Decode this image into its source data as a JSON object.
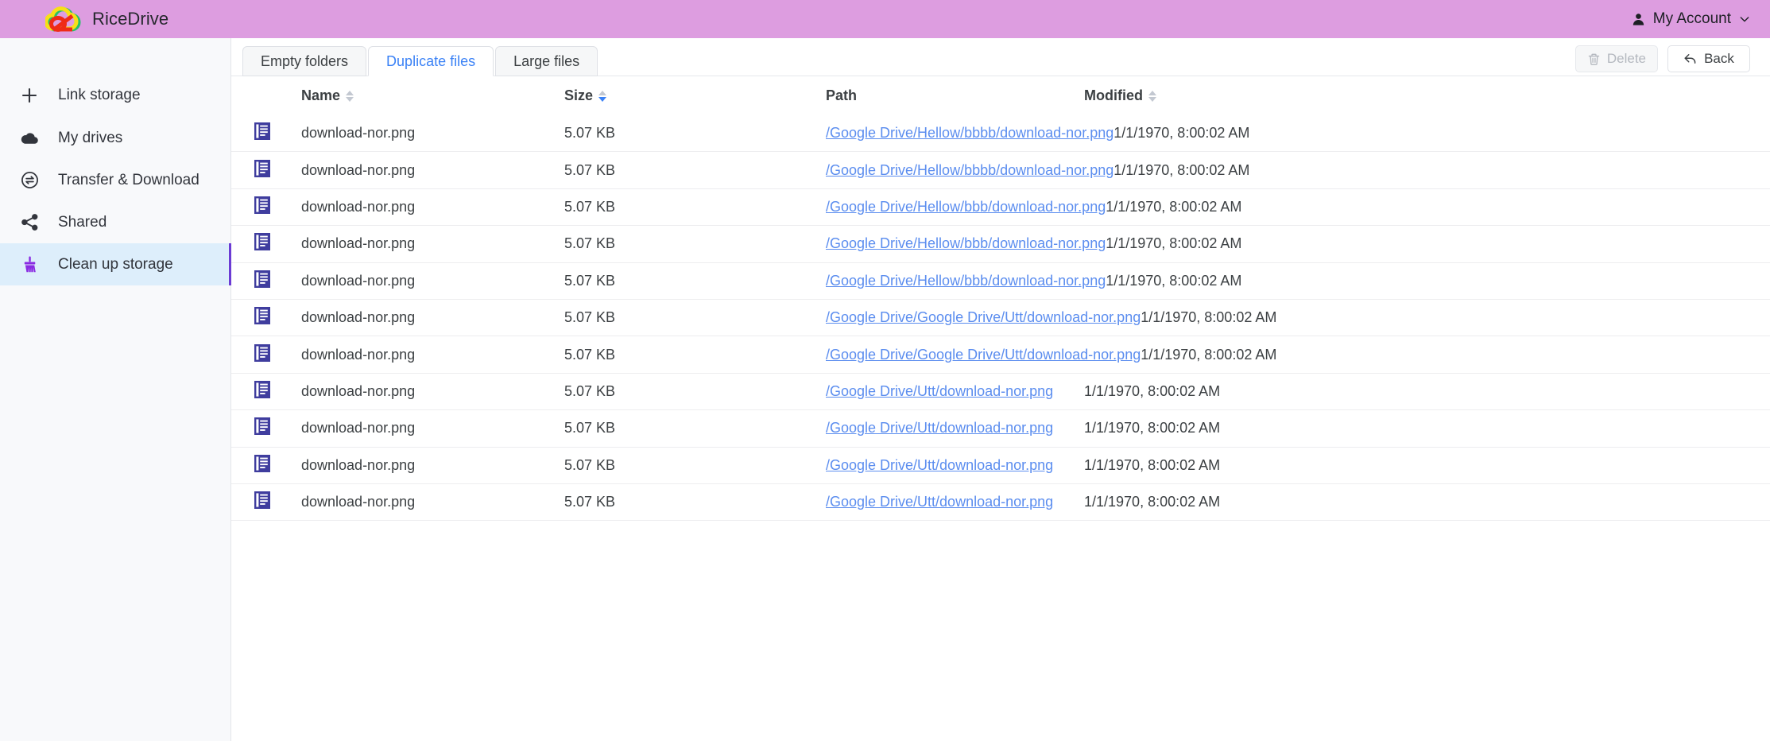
{
  "app": {
    "brand_name": "RiceDrive",
    "logo_icon": "cloud-slash-logo-icon"
  },
  "header": {
    "account_label": "My Account",
    "account_icon": "person-icon",
    "chevron_icon": "chevron-down-icon"
  },
  "sidebar": {
    "items": [
      {
        "label": "Link storage",
        "icon": "plus-icon",
        "active": false
      },
      {
        "label": "My drives",
        "icon": "cloud-icon",
        "active": false
      },
      {
        "label": "Transfer & Download",
        "icon": "transfer-icon",
        "active": false
      },
      {
        "label": "Shared",
        "icon": "share-icon",
        "active": false
      },
      {
        "label": "Clean up storage",
        "icon": "broom-icon",
        "active": true
      }
    ]
  },
  "toolbar": {
    "tabs": [
      {
        "label": "Empty folders",
        "active": false
      },
      {
        "label": "Duplicate files",
        "active": true
      },
      {
        "label": "Large files",
        "active": false
      }
    ],
    "delete_label": "Delete",
    "delete_icon": "trash-icon",
    "delete_disabled": true,
    "back_label": "Back",
    "back_icon": "reply-arrow-icon"
  },
  "table": {
    "columns": [
      {
        "key": "name",
        "label": "Name",
        "sortable": true,
        "sort_state": "none"
      },
      {
        "key": "size",
        "label": "Size",
        "sortable": true,
        "sort_state": "desc"
      },
      {
        "key": "path",
        "label": "Path",
        "sortable": false,
        "sort_state": "none"
      },
      {
        "key": "modified",
        "label": "Modified",
        "sortable": true,
        "sort_state": "none"
      }
    ],
    "row_icon": "document-file-icon",
    "rows": [
      {
        "name": "download-nor.png",
        "size": "5.07 KB",
        "path": "/Google Drive/Hellow/bbbb/download-nor.png",
        "modified": "1/1/1970, 8:00:02 AM"
      },
      {
        "name": "download-nor.png",
        "size": "5.07 KB",
        "path": "/Google Drive/Hellow/bbbb/download-nor.png",
        "modified": "1/1/1970, 8:00:02 AM"
      },
      {
        "name": "download-nor.png",
        "size": "5.07 KB",
        "path": "/Google Drive/Hellow/bbb/download-nor.png",
        "modified": "1/1/1970, 8:00:02 AM"
      },
      {
        "name": "download-nor.png",
        "size": "5.07 KB",
        "path": "/Google Drive/Hellow/bbb/download-nor.png",
        "modified": "1/1/1970, 8:00:02 AM"
      },
      {
        "name": "download-nor.png",
        "size": "5.07 KB",
        "path": "/Google Drive/Hellow/bbb/download-nor.png",
        "modified": "1/1/1970, 8:00:02 AM"
      },
      {
        "name": "download-nor.png",
        "size": "5.07 KB",
        "path": "/Google Drive/Google Drive/Utt/download-nor.png",
        "modified": "1/1/1970, 8:00:02 AM"
      },
      {
        "name": "download-nor.png",
        "size": "5.07 KB",
        "path": "/Google Drive/Google Drive/Utt/download-nor.png",
        "modified": "1/1/1970, 8:00:02 AM"
      },
      {
        "name": "download-nor.png",
        "size": "5.07 KB",
        "path": "/Google Drive/Utt/download-nor.png",
        "modified": "1/1/1970, 8:00:02 AM"
      },
      {
        "name": "download-nor.png",
        "size": "5.07 KB",
        "path": "/Google Drive/Utt/download-nor.png",
        "modified": "1/1/1970, 8:00:02 AM"
      },
      {
        "name": "download-nor.png",
        "size": "5.07 KB",
        "path": "/Google Drive/Utt/download-nor.png",
        "modified": "1/1/1970, 8:00:02 AM"
      },
      {
        "name": "download-nor.png",
        "size": "5.07 KB",
        "path": "/Google Drive/Utt/download-nor.png",
        "modified": "1/1/1970, 8:00:02 AM"
      }
    ]
  },
  "colors": {
    "header_bg": "#dd9de0",
    "sidebar_bg": "#f8f9fb",
    "active_nav_bg": "#ddeefb",
    "accent_purple": "#6b3bd4",
    "link_blue": "#5b8def",
    "active_tab_text": "#3b82f6",
    "file_icon": "#3f3d9e"
  }
}
